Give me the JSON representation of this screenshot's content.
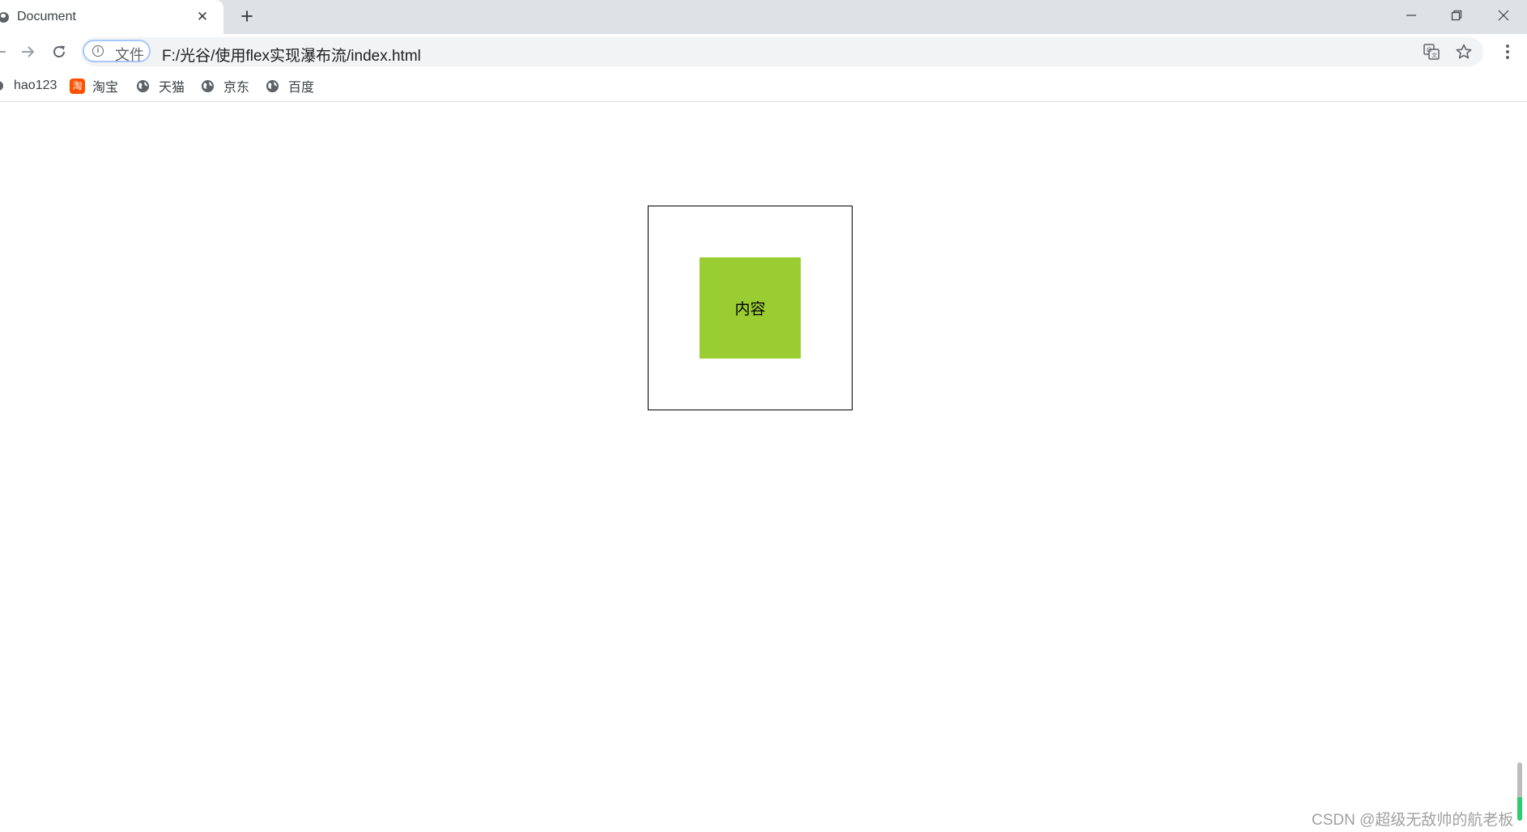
{
  "tab": {
    "title": "Document",
    "close_glyph": "✕",
    "favicon": "globe-icon"
  },
  "new_tab_glyph": "+",
  "window_controls": [
    "minimize-icon",
    "restore-icon",
    "close-icon"
  ],
  "toolbar": {
    "back_icon": "back-arrow-icon",
    "forward_icon": "forward-arrow-icon",
    "reload_icon": "reload-icon",
    "site_info_label": "文件",
    "site_info_icon": "info-icon",
    "url": "F:/光谷/使用flex实现瀑布流/index.html",
    "translate_icon": "translate-icon",
    "bookmark_icon": "star-icon",
    "menu_icon": "more-vert-icon"
  },
  "bookmarks": [
    {
      "label": "hao123",
      "icon": "globe-icon"
    },
    {
      "label": "淘宝",
      "icon": "taobao-icon",
      "icon_text": "淘"
    },
    {
      "label": "天猫",
      "icon": "globe-icon"
    },
    {
      "label": "京东",
      "icon": "globe-icon"
    },
    {
      "label": "百度",
      "icon": "globe-icon"
    }
  ],
  "content": {
    "inner_text": "内容",
    "inner_color": "#9acd32",
    "border_color": "#000000"
  },
  "watermark": "CSDN @超级无敌帅的航老板",
  "scroll_indicator": {
    "fill_fraction": 0.4,
    "fill_color": "#2ecc71"
  }
}
